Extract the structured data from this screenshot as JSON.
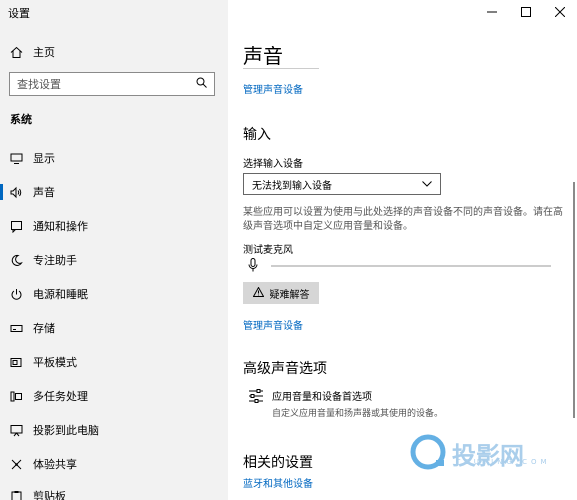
{
  "window": {
    "title": "设置"
  },
  "sidebar": {
    "home_label": "主页",
    "search_placeholder": "查找设置",
    "section_label": "系统",
    "items": [
      {
        "label": "显示",
        "icon": "monitor-icon"
      },
      {
        "label": "声音",
        "icon": "speaker-icon",
        "active": true
      },
      {
        "label": "通知和操作",
        "icon": "notification-icon"
      },
      {
        "label": "专注助手",
        "icon": "moon-icon"
      },
      {
        "label": "电源和睡眠",
        "icon": "power-icon"
      },
      {
        "label": "存储",
        "icon": "storage-icon"
      },
      {
        "label": "平板模式",
        "icon": "tablet-icon"
      },
      {
        "label": "多任务处理",
        "icon": "multitask-icon"
      },
      {
        "label": "投影到此电脑",
        "icon": "project-icon"
      },
      {
        "label": "体验共享",
        "icon": "share-icon"
      },
      {
        "label": "剪贴板",
        "icon": "clipboard-icon"
      }
    ]
  },
  "main": {
    "title": "声音",
    "manage_devices_link_top": "管理声音设备",
    "input_heading": "输入",
    "select_input_label": "选择输入设备",
    "input_dropdown_value": "无法找到输入设备",
    "input_description": "某些应用可以设置为使用与此处选择的声音设备不同的声音设备。请在高级声音选项中自定义应用音量和设备。",
    "test_mic_label": "测试麦克风",
    "mic_level": 0,
    "troubleshoot_label": "疑难解答",
    "manage_devices_link_bottom": "管理声音设备",
    "advanced_heading": "高级声音选项",
    "advanced_item_title": "应用音量和设备首选项",
    "advanced_item_desc": "自定义应用音量和扬声器或其使用的设备。",
    "related_heading": "相关的设置",
    "bluetooth_link": "蓝牙和其他设备"
  },
  "watermark": {
    "text": "投影网",
    "sub": "TOUYING.COM"
  },
  "colors": {
    "accent": "#0067c0",
    "sidebar_bg": "#f2f2f2"
  }
}
